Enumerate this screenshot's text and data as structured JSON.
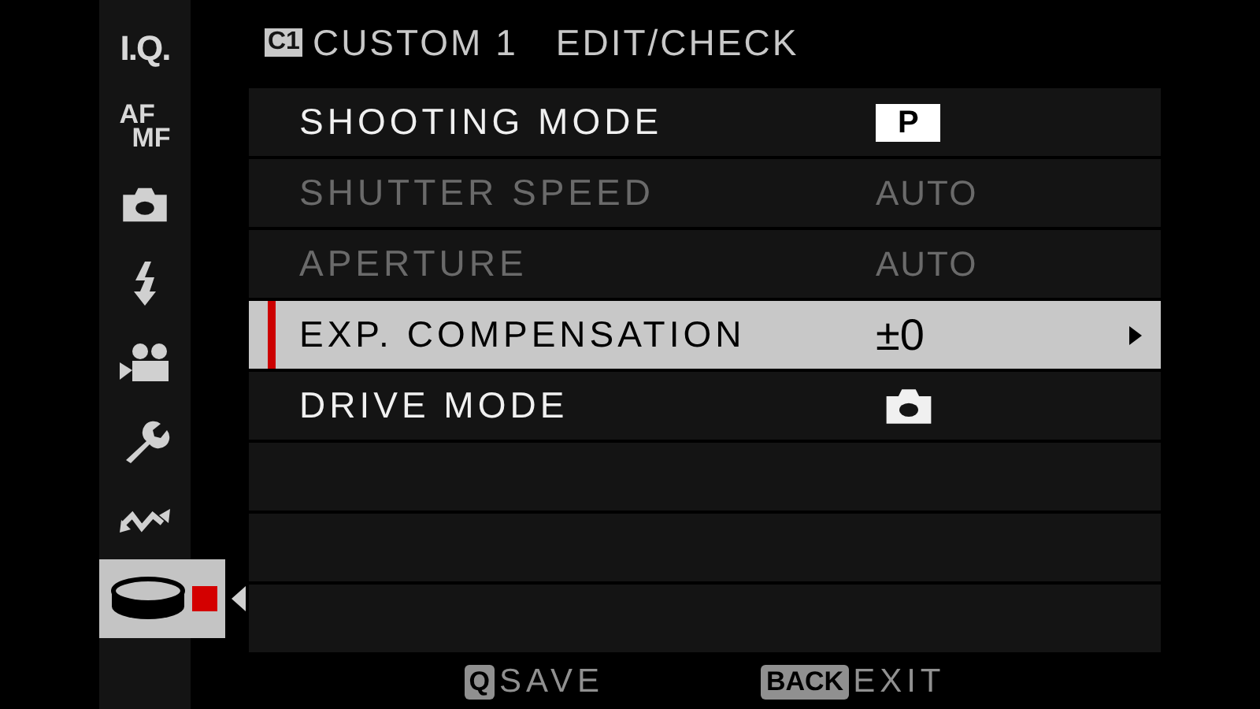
{
  "header": {
    "badge": "C1",
    "title": "CUSTOM 1",
    "subtitle": "EDIT/CHECK"
  },
  "sidebar": {
    "items": [
      {
        "kind": "text",
        "label": "I.Q.",
        "selected": false
      },
      {
        "kind": "stacked",
        "lines": [
          "AF",
          "MF"
        ],
        "selected": false
      },
      {
        "kind": "camera",
        "selected": false
      },
      {
        "kind": "flash",
        "selected": false
      },
      {
        "kind": "movie",
        "selected": false
      },
      {
        "kind": "wrench",
        "selected": false
      },
      {
        "kind": "wave",
        "selected": false
      },
      {
        "kind": "custom",
        "selected": true
      }
    ]
  },
  "rows": [
    {
      "label": "SHOOTING MODE",
      "kind": "badge",
      "value": "P",
      "disabled": false,
      "selected": false
    },
    {
      "label": "SHUTTER SPEED",
      "kind": "text",
      "value": "AUTO",
      "disabled": true,
      "selected": false
    },
    {
      "label": "APERTURE",
      "kind": "text",
      "value": "AUTO",
      "disabled": true,
      "selected": false
    },
    {
      "label": "EXP. COMPENSATION",
      "kind": "text",
      "value": "±0",
      "disabled": false,
      "selected": true
    },
    {
      "label": "DRIVE MODE",
      "kind": "camera",
      "disabled": false,
      "selected": false
    }
  ],
  "footer": [
    {
      "key": "Q",
      "label": "SAVE"
    },
    {
      "key": "BACK",
      "label": "EXIT"
    }
  ]
}
